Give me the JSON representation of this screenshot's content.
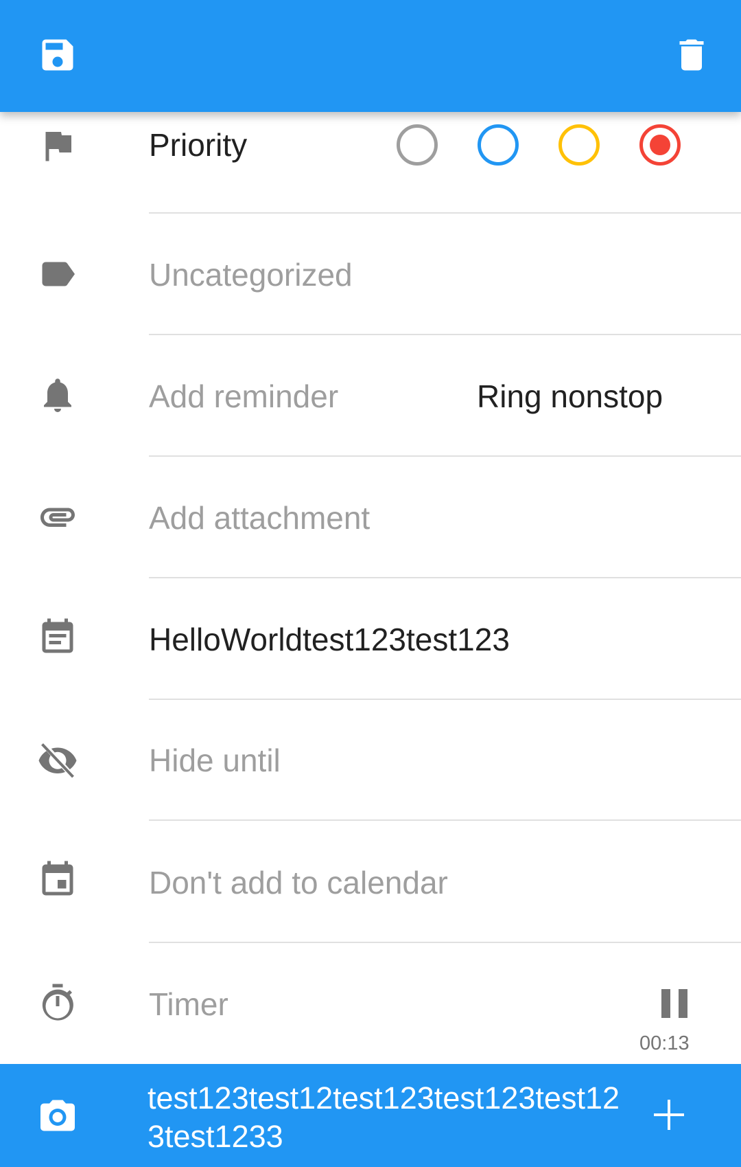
{
  "toolbar": {
    "save_icon": "save-icon",
    "delete_icon": "delete-icon"
  },
  "priority": {
    "label": "Priority",
    "options": [
      {
        "color": "#9e9e9e",
        "selected": false
      },
      {
        "color": "#2196F3",
        "selected": false
      },
      {
        "color": "#FFC107",
        "selected": false
      },
      {
        "color": "#F44336",
        "selected": true
      }
    ]
  },
  "category": {
    "label": "Uncategorized"
  },
  "reminder": {
    "label": "Add reminder",
    "mode": "Ring nonstop"
  },
  "attachment": {
    "label": "Add attachment"
  },
  "description": {
    "value": "HelloWorldtest123test123"
  },
  "hide_until": {
    "label": "Hide until"
  },
  "calendar": {
    "label": "Don't add to calendar"
  },
  "timer": {
    "label": "Timer",
    "elapsed": "00:13"
  },
  "comment": {
    "value": "test123test12test123test123test123test1233"
  },
  "colors": {
    "accent": "#2196F3",
    "icon": "#757575"
  }
}
